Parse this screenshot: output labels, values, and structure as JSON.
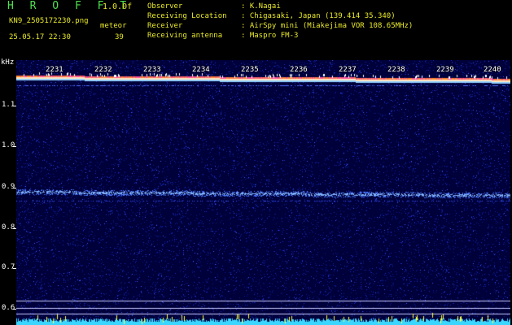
{
  "header": {
    "brand": "H R O F F T",
    "version": "1.0.0f",
    "filename": "KN9_2505172230.png",
    "meteor_label": "meteor",
    "timestamp": "25.05.17 22:30",
    "meteor_count": "39",
    "meta": [
      {
        "key": "Observer",
        "value": ": K.Nagai"
      },
      {
        "key": "Receiving Location",
        "value": ": Chigasaki, Japan (139.414 35.340)"
      },
      {
        "key": "Receiver",
        "value": ": AirSpy mini (Miakejima VOR 108.65MHz)"
      },
      {
        "key": "Receiving antenna",
        "value": ": Maspro FM-3"
      }
    ]
  },
  "axis": {
    "unit": "kHz",
    "y_labels": [
      "1.1",
      "1.0",
      "0.9",
      "0.8",
      "0.7",
      "0.6"
    ],
    "x_labels": [
      "2231",
      "2232",
      "2233",
      "2234",
      "2235",
      "2236",
      "2237",
      "2238",
      "2239",
      "2240"
    ]
  },
  "colors": {
    "background": "#00003a",
    "noise": "#1a2fc8",
    "signal": "#7fb2ff",
    "carrier": "#ff8a2a",
    "baseline": "#3ad6ff",
    "text_yellow": "#e9e92a",
    "text_green": "#4fe04f"
  }
}
